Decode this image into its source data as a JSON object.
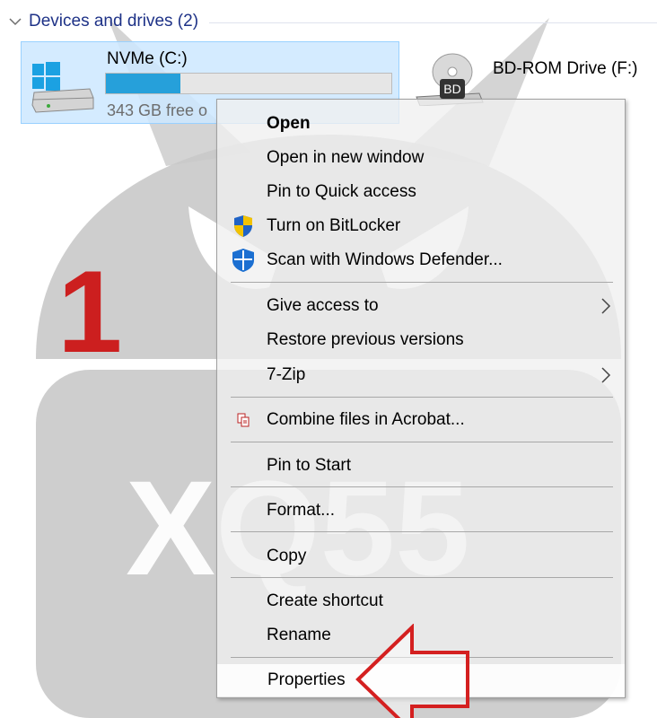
{
  "section": {
    "title": "Devices and drives (2)"
  },
  "drives": [
    {
      "name": "NVMe (C:)",
      "free_text": "343 GB free o",
      "used_fraction": 0.26
    },
    {
      "name": "BD-ROM Drive (F:)",
      "badge": "BD"
    }
  ],
  "context_menu": {
    "items": [
      {
        "label": "Open",
        "bold": true,
        "icon": ""
      },
      {
        "label": "Open in new window",
        "icon": ""
      },
      {
        "label": "Pin to Quick access",
        "icon": ""
      },
      {
        "label": "Turn on BitLocker",
        "icon": "uac-shield-icon"
      },
      {
        "label": "Scan with Windows Defender...",
        "icon": "windows-defender-icon"
      },
      {
        "label": "Give access to",
        "submenu": true
      },
      {
        "label": "Restore previous versions"
      },
      {
        "label": "7-Zip",
        "submenu": true
      },
      {
        "label": "Combine files in Acrobat...",
        "icon": "acrobat-combine-icon"
      },
      {
        "label": "Pin to Start"
      },
      {
        "label": "Format..."
      },
      {
        "label": "Copy"
      },
      {
        "label": "Create shortcut"
      },
      {
        "label": "Rename"
      },
      {
        "label": "Properties"
      }
    ]
  },
  "annotation": {
    "step_number": "1",
    "watermark_text": "XQ55"
  },
  "colors": {
    "header_text": "#1e3287",
    "selection_bg": "#cce8ff",
    "progress_fill": "#26a0da",
    "annotation_red": "#cc1f1f"
  }
}
